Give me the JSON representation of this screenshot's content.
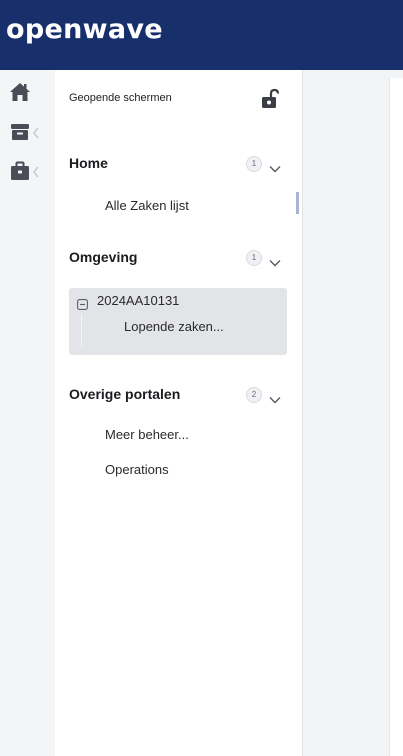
{
  "header": {
    "logo_text": "openwave",
    "background": "#17306c"
  },
  "icon_rail": {
    "items": [
      {
        "icon": "home-icon"
      },
      {
        "icon": "archive-box-icon"
      },
      {
        "icon": "briefcase-icon"
      }
    ]
  },
  "panel": {
    "header_label": "Geopende schermen",
    "lock_icon": "unlocked-padlock-icon",
    "sections": [
      {
        "title": "Home",
        "count": "1",
        "items": [
          "Alle Zaken lijst"
        ]
      },
      {
        "title": "Omgeving",
        "count": "1",
        "case": {
          "id": "2024AA10131",
          "sub_item": "Lopende zaken..."
        }
      },
      {
        "title": "Overige portalen",
        "count": "2",
        "items": [
          "Meer beheer...",
          "Operations"
        ]
      }
    ]
  }
}
